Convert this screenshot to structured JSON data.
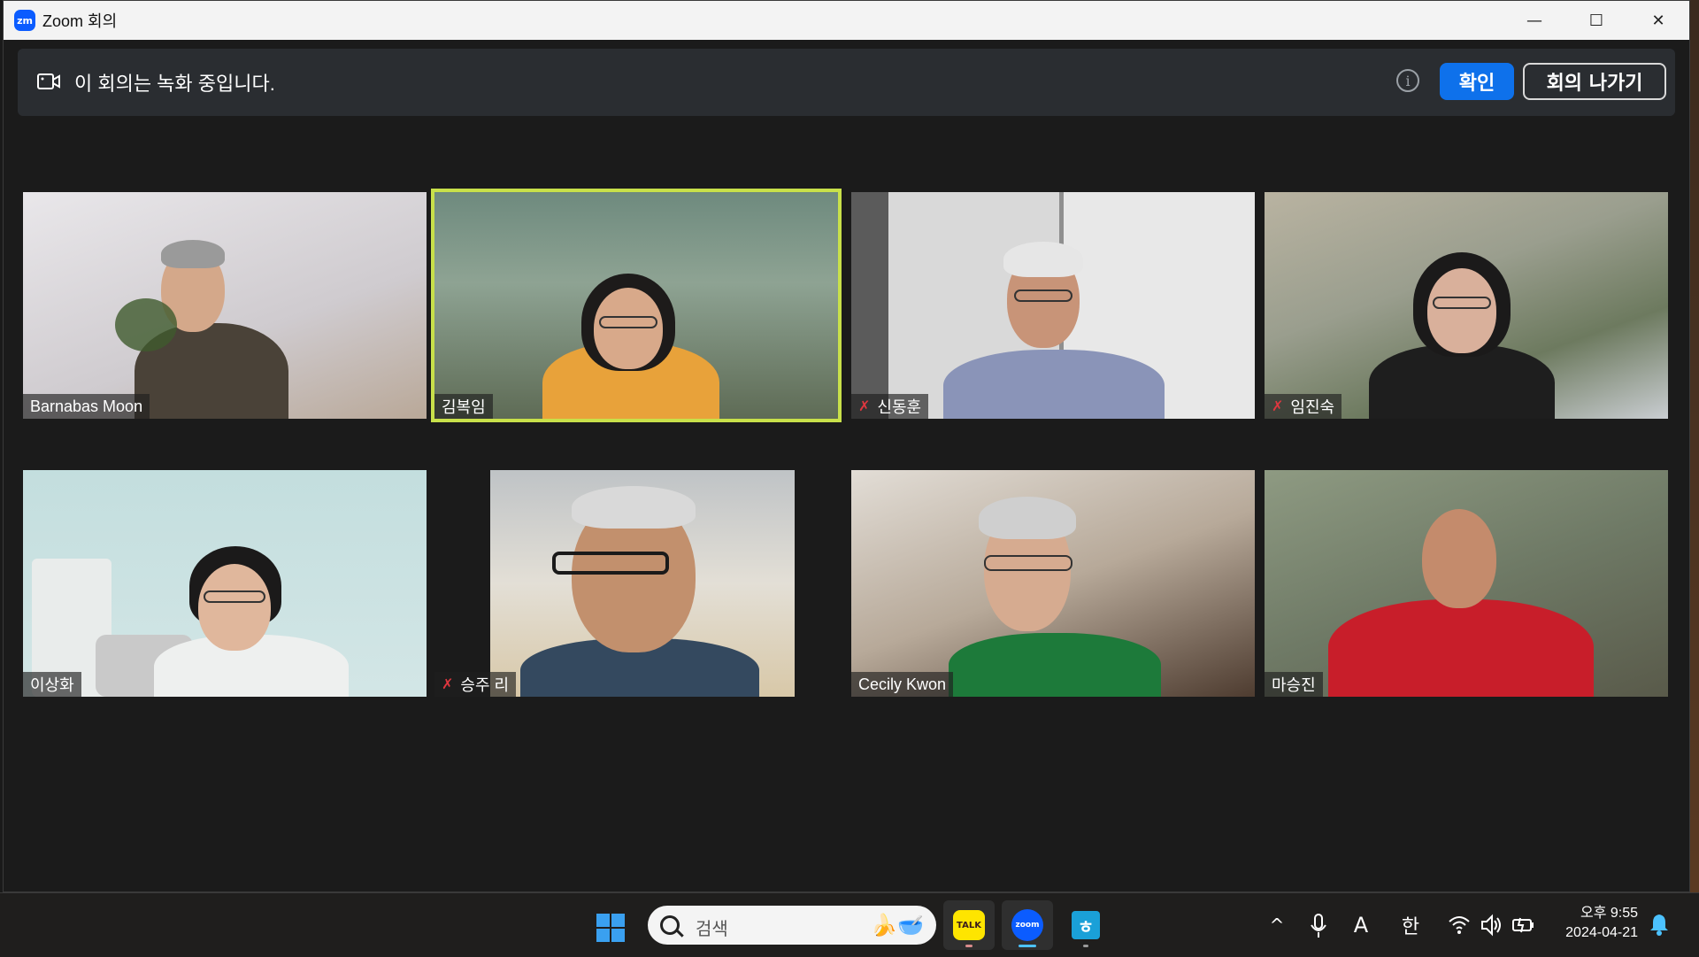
{
  "window": {
    "title": "Zoom 회의",
    "app_logo": "zm",
    "controls": [
      "minimize-icon",
      "maximize-icon",
      "close-icon"
    ],
    "minimize_glyph": "—",
    "maximize_glyph": "☐",
    "close_glyph": "✕"
  },
  "banner": {
    "icon": "video-record-icon",
    "text": "이 회의는 녹화 중입니다.",
    "info_glyph": "i",
    "ok_label": "확인",
    "leave_label": "회의 나가기",
    "ok_color": "#0e71eb"
  },
  "participants": [
    {
      "name": "Barnabas Moon",
      "muted": false,
      "active": false
    },
    {
      "name": "김복임",
      "muted": false,
      "active": true
    },
    {
      "name": "신동훈",
      "muted": true,
      "active": false
    },
    {
      "name": "임진숙",
      "muted": true,
      "active": false
    },
    {
      "name": "이상화",
      "muted": false,
      "active": false
    },
    {
      "name": "승주 리",
      "muted": true,
      "active": false
    },
    {
      "name": "Cecily Kwon",
      "muted": false,
      "active": false
    },
    {
      "name": "마승진",
      "muted": false,
      "active": false
    }
  ],
  "active_speaker_color": "#c8e04a",
  "mute_glyph": "✗",
  "taskbar": {
    "search_placeholder": "검색",
    "search_deco": "🍌🥣",
    "apps": [
      {
        "name": "KakaoTalk",
        "label": "TALK",
        "open": true
      },
      {
        "name": "Zoom",
        "label": "zoom",
        "open": true
      },
      {
        "name": "Hangul",
        "label": "ㅎ",
        "open": false
      }
    ],
    "tray": {
      "chevron": "^",
      "ime_a": "A",
      "ime_han": "한"
    },
    "clock_time": "오후 9:55",
    "clock_date": "2024-04-21"
  }
}
